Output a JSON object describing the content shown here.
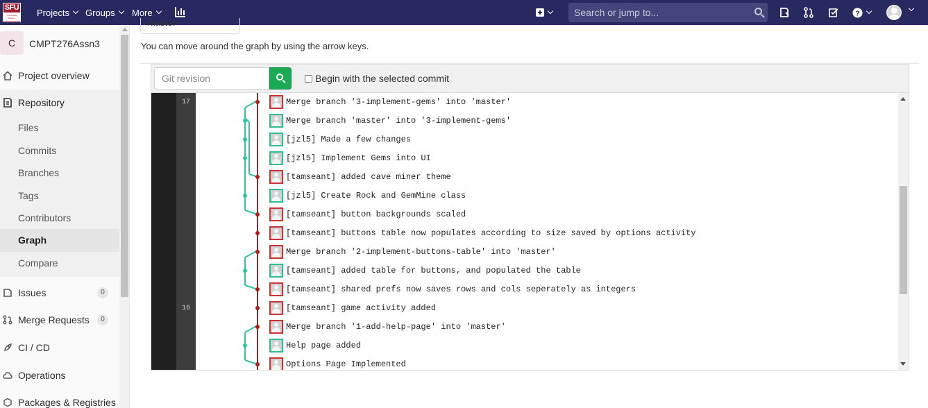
{
  "navbar": {
    "logo_text": "SFU",
    "logo_subtext": "Computing Science",
    "projects": "Projects",
    "groups": "Groups",
    "more": "More",
    "search_placeholder": "Search or jump to..."
  },
  "sidebar": {
    "project_initial": "C",
    "project_name": "CMPT276Assn3",
    "items": [
      {
        "label": "Project overview"
      },
      {
        "label": "Repository"
      },
      {
        "label": "Files"
      },
      {
        "label": "Commits"
      },
      {
        "label": "Branches"
      },
      {
        "label": "Tags"
      },
      {
        "label": "Contributors"
      },
      {
        "label": "Graph"
      },
      {
        "label": "Compare"
      },
      {
        "label": "Issues",
        "count": "0"
      },
      {
        "label": "Merge Requests",
        "count": "0"
      },
      {
        "label": "CI / CD"
      },
      {
        "label": "Operations"
      },
      {
        "label": "Packages & Registries"
      }
    ]
  },
  "main": {
    "branch": "master",
    "hint": "You can move around the graph by using the arrow keys.",
    "revision_placeholder": "Git revision",
    "checkbox_label": "Begin with the selected commit"
  },
  "graph": {
    "days": [
      "17",
      "16"
    ],
    "commits": [
      {
        "message": "Merge branch '3-implement-gems' into 'master'",
        "author": "red"
      },
      {
        "message": "Merge branch 'master' into '3-implement-gems'",
        "author": "teal"
      },
      {
        "message": "[jzl5] Made a few changes",
        "author": "teal"
      },
      {
        "message": "[jzl5] Implement Gems into UI",
        "author": "teal"
      },
      {
        "message": "[tamseant] added cave miner theme",
        "author": "red"
      },
      {
        "message": "[jzl5] Create Rock and GemMine class",
        "author": "teal"
      },
      {
        "message": "[tamseant] button backgrounds scaled",
        "author": "red"
      },
      {
        "message": "[tamseant] buttons table now populates according to size saved by options activity",
        "author": "red"
      },
      {
        "message": "Merge branch '2-implement-buttons-table' into 'master'",
        "author": "red"
      },
      {
        "message": "[tamseant] added table for buttons, and populated the table",
        "author": "teal"
      },
      {
        "message": "[tamseant] shared prefs now saves rows and cols seperately as integers",
        "author": "red"
      },
      {
        "message": "[tamseant] game activity added",
        "author": "red"
      },
      {
        "message": "Merge branch '1-add-help-page' into 'master'",
        "author": "red"
      },
      {
        "message": "Help page added",
        "author": "teal"
      },
      {
        "message": "Options Page Implemented",
        "author": "red"
      }
    ],
    "colors": {
      "master": "#b31b1b",
      "branch": "#2ec4a0"
    }
  }
}
